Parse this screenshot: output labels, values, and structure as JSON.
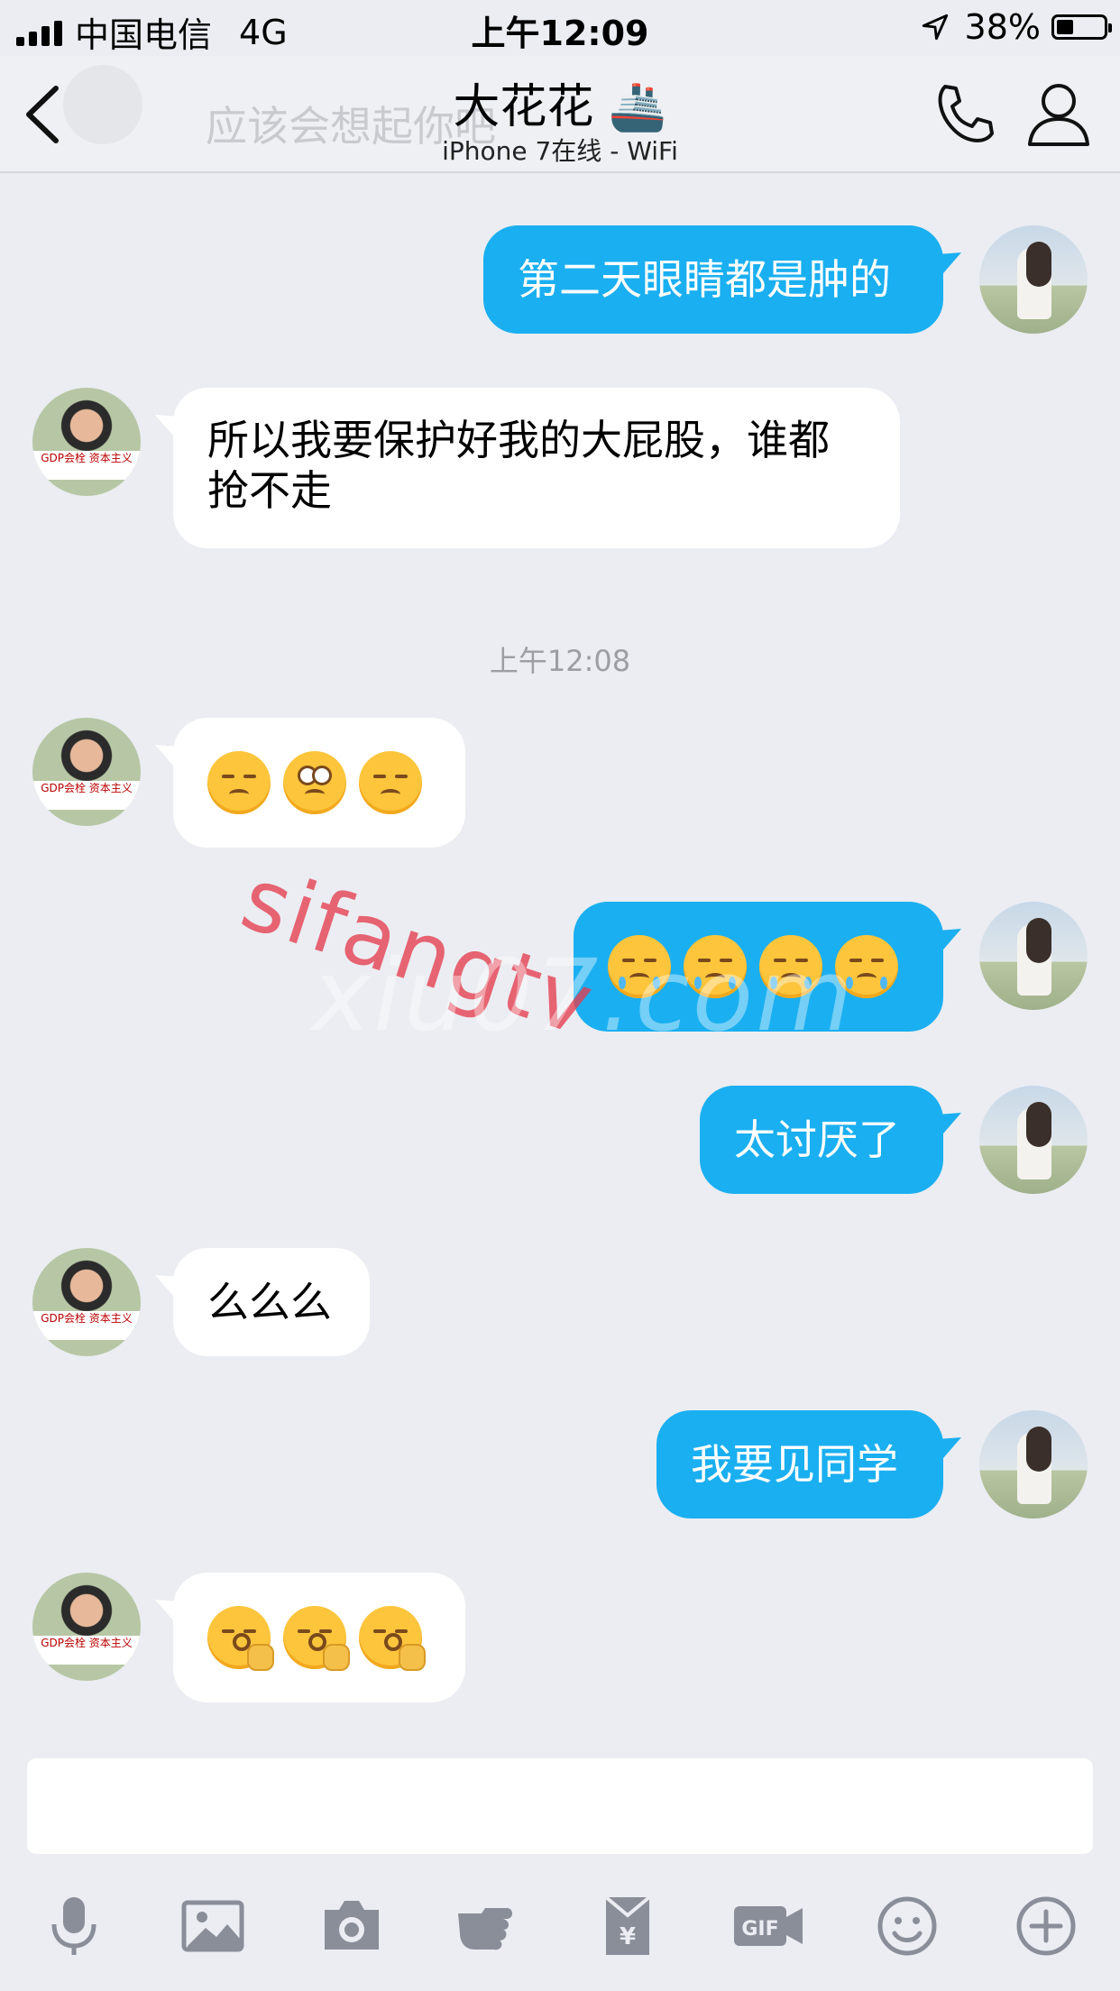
{
  "status_bar": {
    "carrier": "中国电信",
    "network": "4G",
    "time": "上午12:09",
    "battery": "38%",
    "battery_level": 0.38
  },
  "nav": {
    "back_icon": "chevron-left-icon",
    "title": "大花花 🚢",
    "subtitle": "iPhone 7在线 - WiFi",
    "ghost_text": "应该会想起你吧",
    "call_icon": "phone-icon",
    "profile_icon": "person-icon"
  },
  "messages": [
    {
      "from": "me",
      "text": "第二天眼睛都是肿的"
    },
    {
      "from": "them",
      "text": "所以我要保护好我的大屁股，谁都抢不走"
    },
    {
      "timestamp": "上午12:08"
    },
    {
      "from": "them",
      "emoji": [
        "sad-face-emoji",
        "eye-roll-emoji",
        "sad-face-emoji"
      ]
    },
    {
      "from": "me",
      "emoji": [
        "crying-face-emoji",
        "crying-face-emoji",
        "crying-face-emoji",
        "crying-face-emoji"
      ]
    },
    {
      "from": "me",
      "text": "太讨厌了"
    },
    {
      "from": "them",
      "text": "么么么"
    },
    {
      "from": "me",
      "text": "我要见同学"
    },
    {
      "from": "them",
      "emoji": [
        "kissing-hand-emoji",
        "kissing-hand-emoji",
        "kissing-hand-emoji"
      ]
    }
  ],
  "avatar_them_banner": "GDP会栓 资本主义",
  "watermarks": [
    "sifangtv",
    "xiu07.com"
  ],
  "composer": {
    "value": ""
  },
  "toolbar": [
    "microphone-icon",
    "image-icon",
    "camera-icon",
    "poke-icon",
    "red-packet-icon",
    "gif-icon",
    "emoji-icon",
    "plus-icon"
  ],
  "colors": {
    "my_bubble": "#1aaff1",
    "their_bubble": "#ffffff",
    "background": "#ebedf2"
  }
}
